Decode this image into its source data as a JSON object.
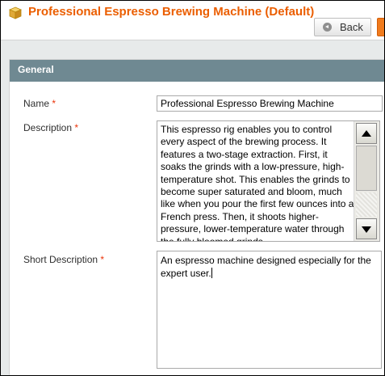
{
  "header": {
    "title": "Professional Espresso Brewing Machine (Default)",
    "icon": "product-box-icon",
    "back_label": "Back"
  },
  "section": {
    "title": "General"
  },
  "form": {
    "name": {
      "label": "Name",
      "required_mark": "*",
      "value": "Professional Espresso Brewing Machine"
    },
    "description": {
      "label": "Description",
      "required_mark": "*",
      "value": "This espresso rig enables you to control every aspect of the brewing process. It features a two-stage extraction. First, it soaks the grinds with a low-pressure, high-temperature shot. This enables the grinds to become super saturated and bloom, much like when you pour the first few ounces into a French press. Then, it shoots higher-pressure, lower-temperature water through the fully bloomed grinds."
    },
    "short_description": {
      "label": "Short Description",
      "required_mark": "*",
      "value": "An espresso machine designed especially for the expert user."
    }
  },
  "colors": {
    "title": "#eb5e00",
    "section_header": "#6f8992",
    "required": "#eb340a",
    "accent_button": "#f07b1d"
  }
}
